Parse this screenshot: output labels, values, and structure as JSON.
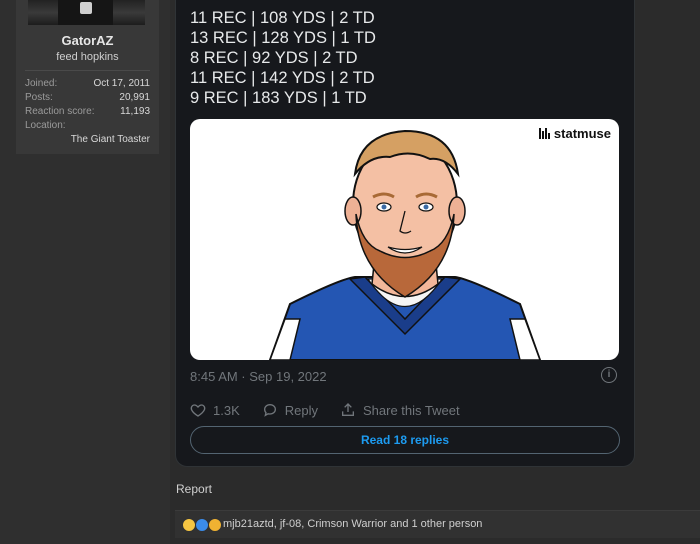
{
  "user": {
    "name": "GatorAZ",
    "title": "feed hopkins",
    "stats": [
      {
        "label": "Joined:",
        "value": "Oct 17, 2011"
      },
      {
        "label": "Posts:",
        "value": "20,991"
      },
      {
        "label": "Reaction score:",
        "value": "11,193"
      }
    ],
    "location_label": "Location:",
    "location_value": "The Giant Toaster"
  },
  "tweet": {
    "lines": [
      "11 REC | 108 YDS | 2 TD",
      "13 REC | 128 YDS | 1 TD",
      "8 REC | 92 YDS | 2 TD",
      "11 REC | 142 YDS | 2 TD",
      "9 REC | 183 YDS | 1 TD"
    ],
    "media_brand": "statmuse",
    "timestamp": "8:45 AM · Sep 19, 2022",
    "likes": "1.3K",
    "reply_label": "Reply",
    "share_label": "Share this Tweet",
    "read_replies": "Read 18 replies"
  },
  "post": {
    "report_label": "Report",
    "reactions_text": "mjb21aztd, jf-08, Crimson Warrior and 1 other person"
  },
  "colors": {
    "accent_blue": "#1d9bf0",
    "tweet_bg": "#16181c",
    "page_bg": "#2b2b2b"
  },
  "icons": [
    "heart-icon",
    "reply-icon",
    "share-icon",
    "info-icon",
    "statmuse-logo-icon"
  ]
}
